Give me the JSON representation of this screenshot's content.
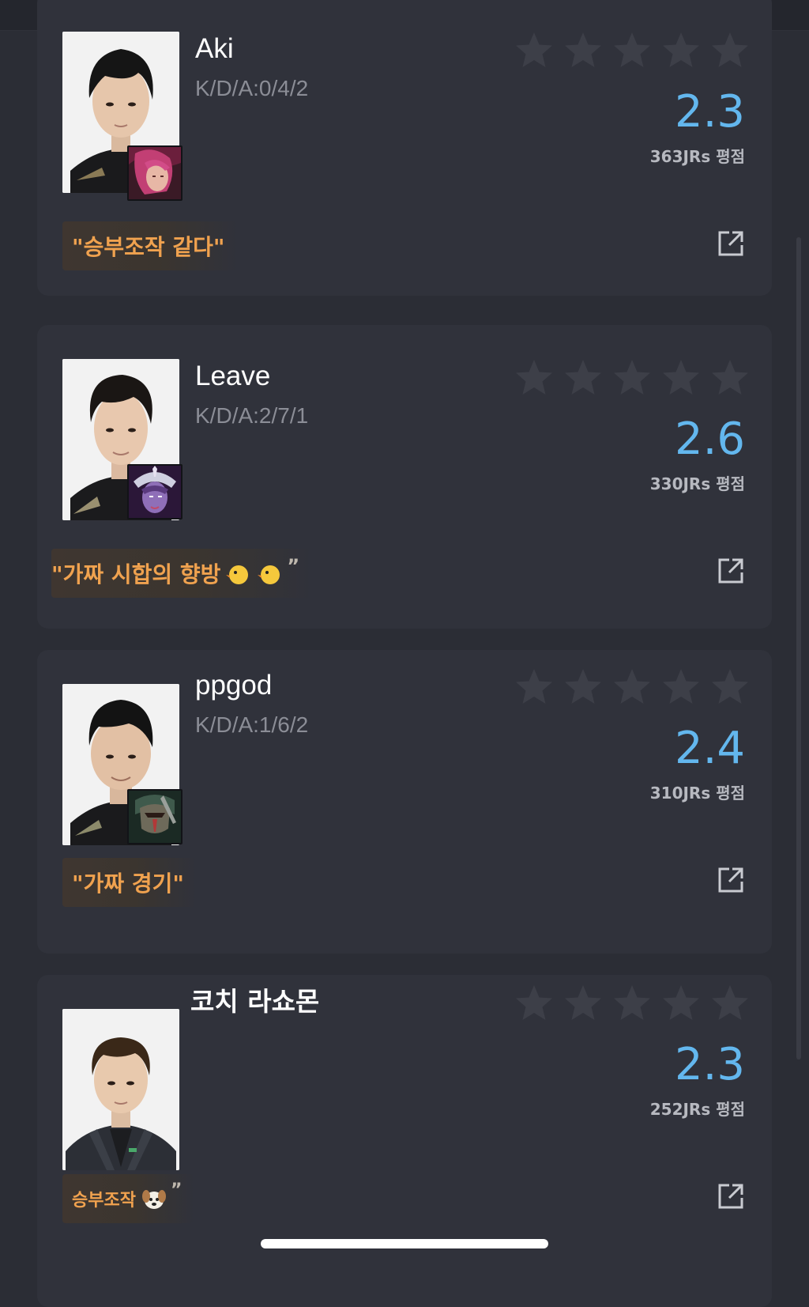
{
  "colors": {
    "background": "#2b2d35",
    "card": "#30323b",
    "score": "#63b7ee",
    "quote_text": "#f0a24f",
    "star_empty": "#3d3f48"
  },
  "players": [
    {
      "name": "Aki",
      "kda": "K/D/A:0/4/2",
      "stars_filled": 0,
      "stars_total": 5,
      "score": "2.3",
      "reviews": "363JRs 평점",
      "quote": "\"승부조작 같다\"",
      "champion_icon": "vayne-icon"
    },
    {
      "name": "Leave",
      "kda": "K/D/A:2/7/1",
      "stars_filled": 0,
      "stars_total": 5,
      "score": "2.6",
      "reviews": "330JRs 평점",
      "quote": "\"가짜 시합의 향방",
      "quote_suffix": "”",
      "quote_emoji": "chick-emoji",
      "champion_icon": "leblanc-icon"
    },
    {
      "name": "ppgod",
      "kda": "K/D/A:1/6/2",
      "stars_filled": 0,
      "stars_total": 5,
      "score": "2.4",
      "reviews": "310JRs 평점",
      "quote": "\"가짜 경기\"",
      "champion_icon": "pyke-icon"
    },
    {
      "name": "코치 라쇼몬",
      "kda": "",
      "stars_filled": 0,
      "stars_total": 5,
      "score": "2.3",
      "reviews": "252JRs 평점",
      "quote": "승부조작",
      "quote_suffix": "”",
      "quote_emoji": "dog-emoji"
    }
  ]
}
